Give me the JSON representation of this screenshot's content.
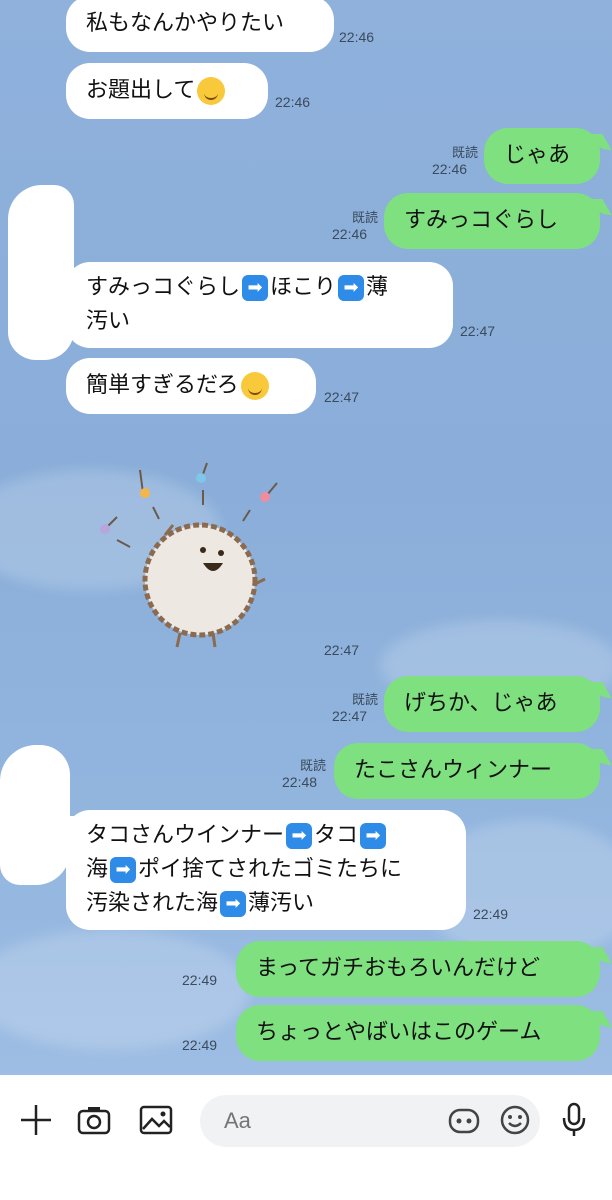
{
  "messages": [
    {
      "text": "私もなんかやりたい",
      "time": "22:46"
    },
    {
      "text": "お題出して",
      "time": "22:46"
    },
    {
      "text": "じゃあ",
      "time": "22:46",
      "read": "既読"
    },
    {
      "text": "すみっコぐらし",
      "time": "22:46",
      "read": "既読"
    },
    {
      "line1a": "すみっコぐらし",
      "line1b": "ほこり",
      "line1c": "薄",
      "line2": "汚い",
      "time": "22:47"
    },
    {
      "text": "簡単すぎるだろ",
      "time": "22:47"
    },
    {
      "sticker": "sumikko-hokori-dancing",
      "time": "22:47"
    },
    {
      "text": "げちか、じゃあ",
      "time": "22:47",
      "read": "既読"
    },
    {
      "text": "たこさんウィンナー",
      "time": "22:48",
      "read": "既読"
    },
    {
      "l1a": "タコさんウインナー",
      "l1b": "タコ",
      "l2a": "海",
      "l2b": "ポイ捨てされたゴミたちに",
      "l3a": "汚染された海",
      "l3b": "薄汚い",
      "time": "22:49"
    },
    {
      "text": "まってガチおもろいんだけど",
      "time": "22:49"
    },
    {
      "text": "ちょっとやばいはこのゲーム",
      "time": "22:49"
    }
  ],
  "arrow_glyph": "➡",
  "input": {
    "placeholder": "Aa"
  },
  "colors": {
    "outgoing": "#7ee07e",
    "incoming": "#ffffff",
    "background": "#8aaed9"
  }
}
